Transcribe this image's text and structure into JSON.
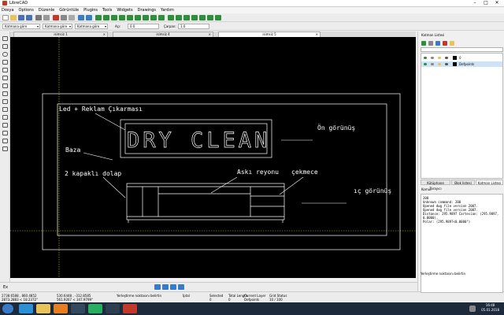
{
  "window": {
    "title": "LibreCAD"
  },
  "menu": [
    "Dosya",
    "Options",
    "Düzenle",
    "Görüntüle",
    "Plugins",
    "Tools",
    "Widgets",
    "Drawings",
    "Yardım"
  ],
  "toolbar2": {
    "combo1": "Katmana göre",
    "combo2": "Katmana göre",
    "combo3": "Katmana göre",
    "angle_label": "Açı:",
    "angle_value": "0.0",
    "factor_label": "Çarpan:",
    "factor_value": "1.0"
  },
  "tabs": [
    {
      "label": "isimsiz 1",
      "active": false
    },
    {
      "label": "isimsiz 4",
      "active": false
    },
    {
      "label": "isimsiz 5",
      "active": true
    }
  ],
  "drawing": {
    "title_text": "DRY CLEAN",
    "labels": {
      "led": "Led + Reklam Çıkarması",
      "baza": "Baza",
      "dolap": "2 kapaklı dolap",
      "reyon": "Askı reyonu",
      "cekmece": "çekmece",
      "on": "Ön görünüş",
      "ic": "ıç görünüş"
    }
  },
  "command": {
    "label": "Ex",
    "prompt": "Yerleştirme noktasını belirtin"
  },
  "status": {
    "coord_abs": "2738.6588 , 860.4852",
    "coord_abs2": "2873.2883 < 18.2372°",
    "coord_rel": "530.6448 , -312.8585",
    "coord_rel2": "561.9267 < 347.9799°",
    "hint": "Yerleştirme noktasını belirtin",
    "hint2": "İptal",
    "selected_label": "Selected",
    "selected_value": "0",
    "length_label": "Total Length",
    "length_value": "0",
    "layer_label": "Current Layer",
    "layer_value": "Defpoints",
    "grid_label": "Grid Status",
    "grid_value": "10 / 100"
  },
  "rightpanel": {
    "layer_title": "Katman Listesi",
    "layers": [
      {
        "name": "0",
        "selected": false
      },
      {
        "name": "Defpoints",
        "selected": true
      }
    ],
    "ptabs": [
      "Kütüphane Tarayıcı",
      "Blok listesi",
      "Katman Listesi"
    ],
    "cmd_title": "Komut",
    "cmd_lines": [
      "200",
      "Unknown command: 200",
      "Opened dwg file version 2007.",
      "Opened dwg file version 2007.",
      "Distance: 295.9897 Cartesian: (295.9897, 0.0000),",
      "Polar: (295.9897<0.0000°)"
    ],
    "cmd_prompt": "Yerleştirme noktasını belirtin"
  },
  "taskbar": {
    "time": "16:48",
    "date": "05.01.2018"
  },
  "colors": {
    "canvas_bg": "#000000",
    "drawing_line": "#ffffff",
    "crosshair": "#d4c03a",
    "taskbar": "#1c2a3c"
  }
}
